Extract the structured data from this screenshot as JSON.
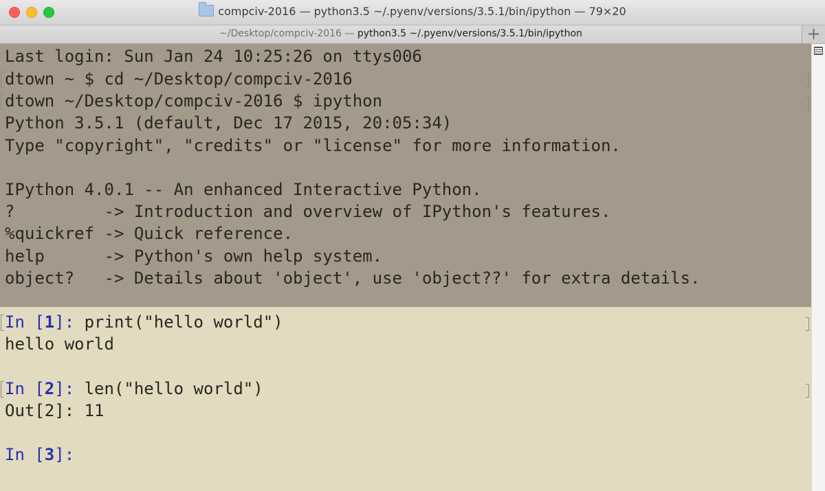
{
  "window": {
    "title": "compciv-2016 — python3.5 ~/.pyenv/versions/3.5.1/bin/ipython — 79×20"
  },
  "tab": {
    "path": "~/Desktop/compciv-2016 — ",
    "command": "python3.5 ~/.pyenv/versions/3.5.1/bin/ipython"
  },
  "new_tab_label": "+",
  "terminal": {
    "welcome_lines": [
      "Last login: Sun Jan 24 10:25:26 on ttys006",
      "dtown ~ $ cd ~/Desktop/compciv-2016",
      "dtown ~/Desktop/compciv-2016 $ ipython",
      "Python 3.5.1 (default, Dec 17 2015, 20:05:34)",
      "Type \"copyright\", \"credits\" or \"license\" for more information.",
      "IPython 4.0.1 -- An enhanced Interactive Python.",
      "?         -> Introduction and overview of IPython's features.",
      "%quickref -> Quick reference.",
      "help      -> Python's own help system.",
      "object?   -> Details about 'object', use 'object??' for extra details."
    ],
    "cells": [
      {
        "prompt_in": "In [",
        "num": "1",
        "prompt_close": "]: ",
        "code": "print(\"hello world\")",
        "output": "hello world"
      },
      {
        "prompt_in": "In [",
        "num": "2",
        "prompt_close": "]: ",
        "code": "len(\"hello world\")",
        "output": "Out[2]: 11"
      },
      {
        "prompt_in": "In [",
        "num": "3",
        "prompt_close": "]: ",
        "code": ""
      }
    ]
  },
  "colors": {
    "welcome_bg": "#a39a8b",
    "terminal_bg": "#e2dbbf",
    "prompt": "#2530b5",
    "text": "#2a2622"
  }
}
